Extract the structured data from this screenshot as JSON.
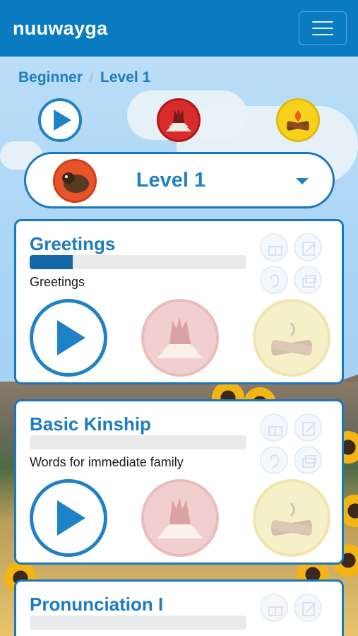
{
  "app": {
    "title": "nuuwayga"
  },
  "header": {
    "menu_icon": "hamburger-menu-icon"
  },
  "breadcrumb": {
    "items": [
      "Beginner",
      "Level 1"
    ],
    "separator": "/"
  },
  "modes": [
    {
      "icon": "play-icon",
      "color": "#1f82c6"
    },
    {
      "icon": "dance-icon",
      "color": "#d92b2b"
    },
    {
      "icon": "campfire-icon",
      "color": "#f6d21c"
    }
  ],
  "level_select": {
    "value": "Level 1",
    "avatar_icon": "buffalo-icon"
  },
  "lessons": [
    {
      "title": "Greetings",
      "description": "Greetings",
      "progress": 0.2
    },
    {
      "title": "Basic Kinship",
      "description": "Words for immediate family",
      "progress": 0
    },
    {
      "title": "Pronunciation I",
      "description": "",
      "progress": 0
    }
  ],
  "colors": {
    "primary": "#0a7ac1",
    "accent": "#1f82c6",
    "dance": "#d92b2b",
    "fire": "#f6d21c"
  }
}
